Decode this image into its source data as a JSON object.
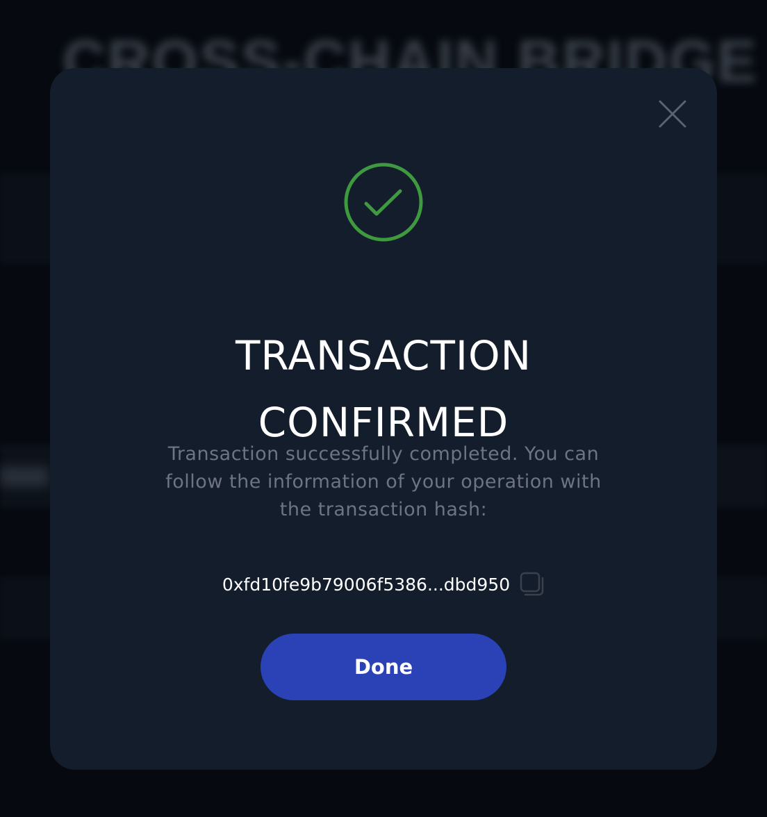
{
  "background": {
    "title": "CROSS-CHAIN BRIDGE"
  },
  "modal": {
    "close_icon": "close-icon",
    "status_icon": "check-circle-icon",
    "title_line1": "TRANSACTION",
    "title_line2": "CONFIRMED",
    "description": "Transaction successfully completed. You can follow the information of your operation with the transaction hash:",
    "tx_hash": "0xfd10fe9b79006f5386...dbd950",
    "copy_icon": "copy-icon",
    "done_label": "Done"
  },
  "colors": {
    "modal_bg": "#141d2c",
    "success_green": "#3f9a3f",
    "button_blue": "#2a42b6",
    "muted_text": "#6d7484"
  }
}
